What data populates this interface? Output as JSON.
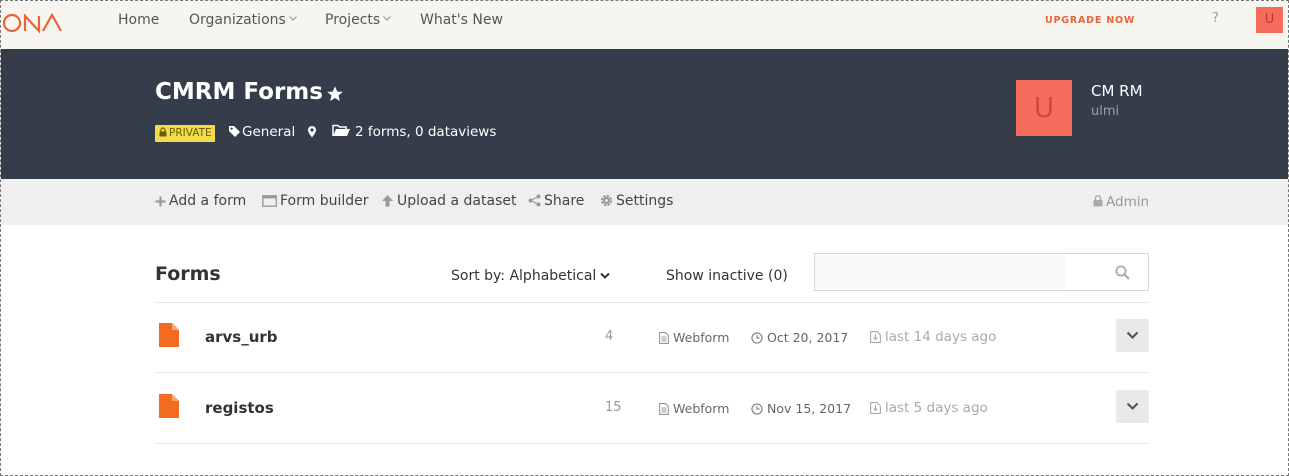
{
  "nav": {
    "home": "Home",
    "organizations": "Organizations",
    "projects": "Projects",
    "whats_new": "What's New",
    "upgrade": "UPGRADE NOW",
    "help": "?",
    "user_initial": "U"
  },
  "project": {
    "title": "CMRM Forms",
    "privacy": "PRIVATE",
    "tag": "General",
    "summary": "2 forms, 0 dataviews",
    "owner_initial": "U",
    "owner_name": "CM RM",
    "owner_username": "ulmi"
  },
  "actions": {
    "add_form": "Add a form",
    "form_builder": "Form builder",
    "upload_dataset": "Upload a dataset",
    "share": "Share",
    "settings": "Settings",
    "admin": "Admin"
  },
  "forms_section": {
    "heading": "Forms",
    "sort_label": "Sort by: Alphabetical",
    "show_inactive": "Show inactive (0)",
    "search_placeholder": ""
  },
  "forms": [
    {
      "name": "arvs_urb",
      "submissions": "4",
      "type": "Webform",
      "date": "Oct 20, 2017",
      "last_submission": "last 14 days ago"
    },
    {
      "name": "registos",
      "submissions": "15",
      "type": "Webform",
      "date": "Nov 15, 2017",
      "last_submission": "last 5 days ago"
    }
  ],
  "colors": {
    "accent_orange": "#f26b21",
    "header_bg": "#343d49",
    "avatar": "#f66c5d",
    "private_badge": "#f3dc4a"
  }
}
